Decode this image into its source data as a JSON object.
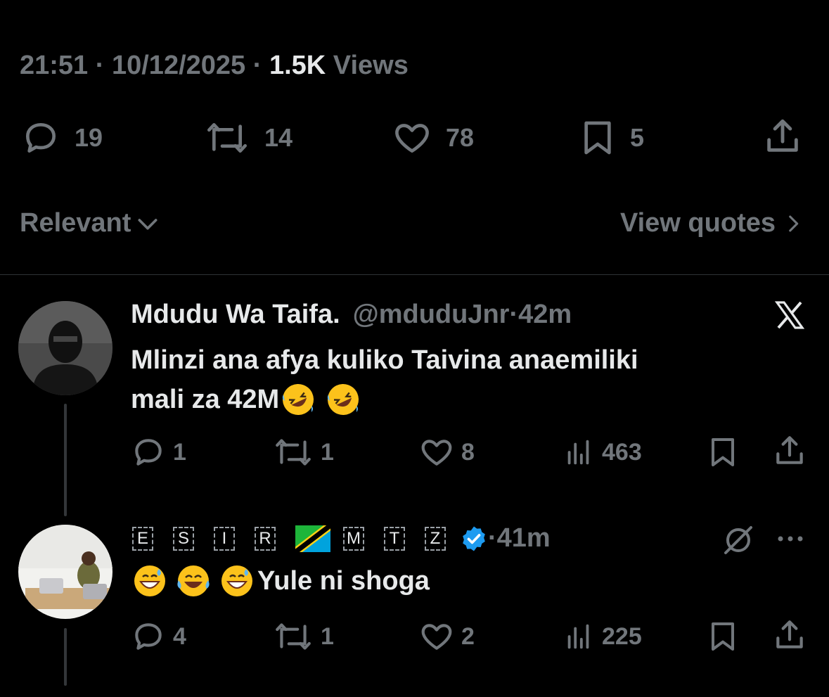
{
  "post_meta": {
    "time": "21:51",
    "sep1": " · ",
    "date": "10/12/2025",
    "sep2": " · ",
    "views_count": "1.5K",
    "views_label": " Views"
  },
  "main_actions": {
    "replies": "19",
    "reposts": "14",
    "likes": "78",
    "bookmarks": "5"
  },
  "sort": {
    "label": "Relevant"
  },
  "quotes": {
    "label": "View quotes"
  },
  "replies": [
    {
      "name": "Mdudu Wa Taifa.",
      "handle": "@mduduJnr",
      "dot": " · ",
      "time": "42m",
      "text_line1": "Mlinzi ana afya kuliko Taivina anaemiliki",
      "text_line2": "mali za 42M",
      "actions": {
        "replies": "1",
        "reposts": "1",
        "likes": "8",
        "views": "463"
      }
    },
    {
      "name_letters": [
        "E",
        "S",
        "I",
        "R",
        "M",
        "T",
        "Z"
      ],
      "dot": " · ",
      "time": "41m",
      "text": "Yule ni shoga",
      "actions": {
        "replies": "4",
        "reposts": "1",
        "likes": "2",
        "views": "225"
      }
    }
  ],
  "colors": {
    "background": "#000000",
    "muted": "#71767b",
    "text": "#e7e9ea",
    "verified": "#1d9bf0"
  }
}
